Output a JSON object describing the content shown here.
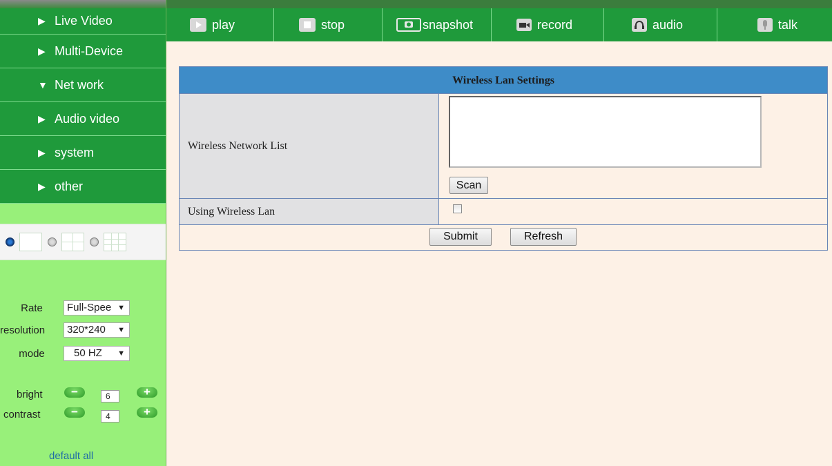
{
  "sidebar": {
    "menu": [
      {
        "label": "Live Video",
        "arrow": "▶",
        "icon": "right-triangle-icon"
      },
      {
        "label": "Multi-Device",
        "arrow": "▶",
        "icon": "right-triangle-icon"
      },
      {
        "label": "Net work",
        "arrow": "▼",
        "icon": "down-triangle-icon"
      },
      {
        "label": "Audio video",
        "arrow": "▶",
        "icon": "right-triangle-icon"
      },
      {
        "label": "system",
        "arrow": "▶",
        "icon": "right-triangle-icon"
      },
      {
        "label": "other",
        "arrow": "▶",
        "icon": "right-triangle-icon"
      }
    ],
    "split_views": [
      {
        "selected": true,
        "icon": "single-view-icon"
      },
      {
        "selected": false,
        "icon": "quad-view-icon"
      },
      {
        "selected": false,
        "icon": "nine-view-icon"
      }
    ],
    "controls": {
      "rate": {
        "label": "Rate",
        "value": "Full-Spee"
      },
      "resolution": {
        "label": "resolution",
        "value": "320*240"
      },
      "mode": {
        "label": "mode",
        "value": "50 HZ"
      }
    },
    "adjust": {
      "bright": {
        "label": "bright",
        "value": "6"
      },
      "contrast": {
        "label": "contrast",
        "value": "4"
      },
      "minus": "−",
      "plus": "+"
    },
    "default_all": "default all"
  },
  "toolbar": {
    "buttons": [
      {
        "label": "play",
        "icon": "play-icon"
      },
      {
        "label": "stop",
        "icon": "stop-icon"
      },
      {
        "label": "snapshot",
        "icon": "camera-icon"
      },
      {
        "label": "record",
        "icon": "video-camera-icon"
      },
      {
        "label": "audio",
        "icon": "headphones-icon"
      },
      {
        "label": "talk",
        "icon": "microphone-icon"
      }
    ]
  },
  "settings": {
    "title": "Wireless Lan Settings",
    "network_list_label": "Wireless Network List",
    "scan_button": "Scan",
    "using_wireless_label": "Using Wireless Lan",
    "using_wireless_checked": false,
    "submit_button": "Submit",
    "refresh_button": "Refresh"
  },
  "colors": {
    "sidebar_bg": "#98f07a",
    "nav_green": "#1f9a3b",
    "title_blue": "#3e8cc8",
    "page_bg": "#fdf1e6"
  }
}
